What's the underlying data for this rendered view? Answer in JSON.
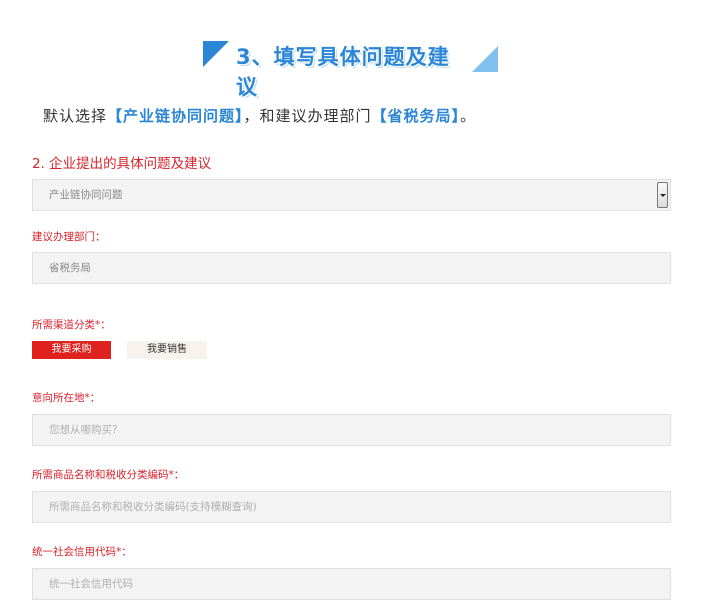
{
  "step": {
    "title": "3、填写具体问题及建议"
  },
  "default_line": {
    "prefix": "默认选择",
    "issue": "【产业链协同问题】",
    "middle": "，和建议办理部门",
    "department": "【省税务局】",
    "suffix": "。"
  },
  "section": {
    "title": "2. 企业提出的具体问题及建议"
  },
  "issue_select": {
    "value": "产业链协同问题"
  },
  "department": {
    "label": "建议办理部门：",
    "value": "省税务局"
  },
  "channel": {
    "label": "所需渠道分类*：",
    "options": [
      "我要采购",
      "我要销售"
    ],
    "selected": "我要采购"
  },
  "location": {
    "label": "意向所在地*：",
    "placeholder": "您想从哪购买?"
  },
  "product": {
    "label": "所需商品名称和税收分类编码*：",
    "placeholder": "所需商品名称和税收分类编码(支持模糊查询)"
  },
  "credit_code": {
    "label": "统一社会信用代码*：",
    "placeholder": "统一社会信用代码"
  },
  "colors": {
    "accent_blue": "#2b86d6",
    "required_red": "#d8242c",
    "active_button": "#e0221f"
  }
}
